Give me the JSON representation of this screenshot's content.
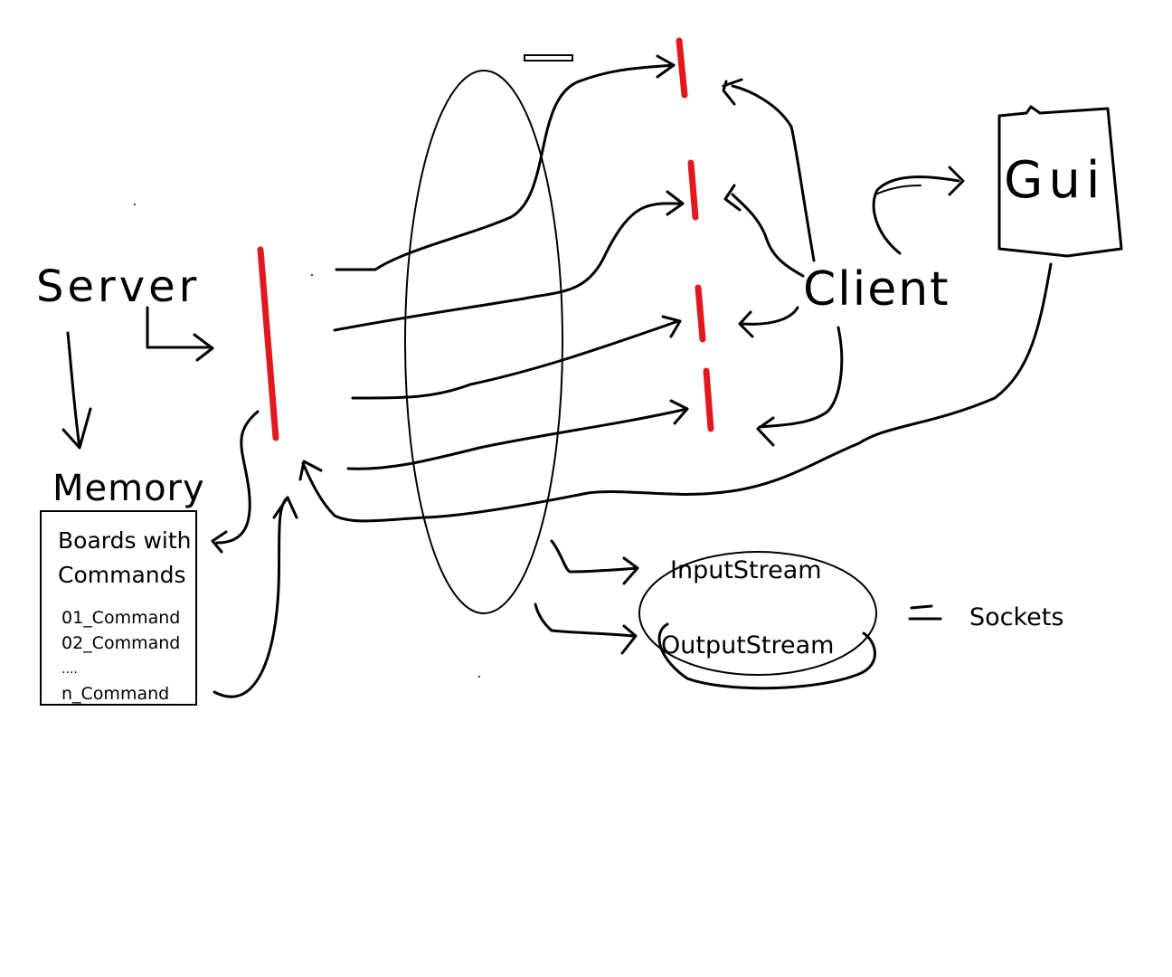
{
  "labels": {
    "server": "Server",
    "memory": "Memory",
    "client": "Client",
    "gui": "Gui",
    "sockets": "Sockets",
    "equals": "=",
    "dash": "—"
  },
  "memory_box": {
    "title_line1": "Boards with",
    "title_line2": "Commands",
    "items": [
      "01_Command",
      "02_Command",
      "....",
      "n_Command"
    ]
  },
  "streams": {
    "input": "InputStream",
    "output": "OutputStream"
  },
  "colors": {
    "socket_marker": "#e1181e",
    "ink": "#000000",
    "background": "#ffffff"
  }
}
